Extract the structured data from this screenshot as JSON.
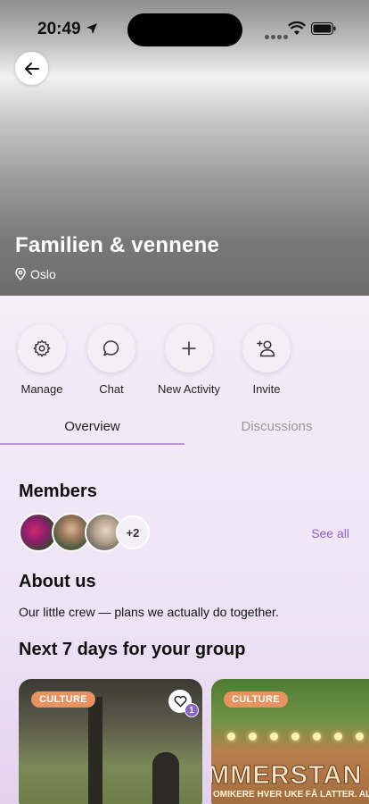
{
  "status_bar": {
    "time": "20:49"
  },
  "hero": {
    "title": "Familien & vennene",
    "location": "Oslo"
  },
  "actions": [
    {
      "label": "Manage",
      "icon": "gear-icon"
    },
    {
      "label": "Chat",
      "icon": "chat-bubble-icon"
    },
    {
      "label": "New Activity",
      "icon": "plus-icon"
    },
    {
      "label": "Invite",
      "icon": "add-person-icon"
    }
  ],
  "tabs": {
    "overview": "Overview",
    "discussions": "Discussions",
    "active": "overview"
  },
  "members": {
    "title": "Members",
    "more_count": "+2",
    "see_all": "See all"
  },
  "about": {
    "title": "About us",
    "text": "Our little crew — plans we actually do together."
  },
  "upcoming": {
    "title": "Next 7 days for your group",
    "cards": [
      {
        "category": "CULTURE",
        "likes": "1"
      },
      {
        "category": "CULTURE",
        "banner": "MMERSTAN",
        "banner_sub": "OMIKERE HVER UKE FÅ LATTER. AL"
      }
    ]
  },
  "colors": {
    "accent": "#8c63c6",
    "badge": "#e6935f",
    "tab_underline": "#b996d4"
  }
}
